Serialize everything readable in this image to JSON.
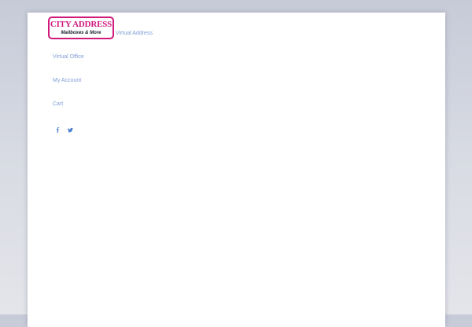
{
  "logo": {
    "title": "CITY ADDRESS",
    "subtitle": "Mailboxes & More",
    "brand_color": "#d0187d"
  },
  "nav": {
    "items": [
      {
        "label": "Virtual Address"
      },
      {
        "label": "Virtual Office"
      },
      {
        "label": "My Account"
      },
      {
        "label": "Cart"
      }
    ],
    "link_color": "#7f9ed6"
  },
  "social": {
    "icons": [
      "facebook-icon",
      "twitter-icon"
    ],
    "icon_color": "#4f7fcf"
  }
}
